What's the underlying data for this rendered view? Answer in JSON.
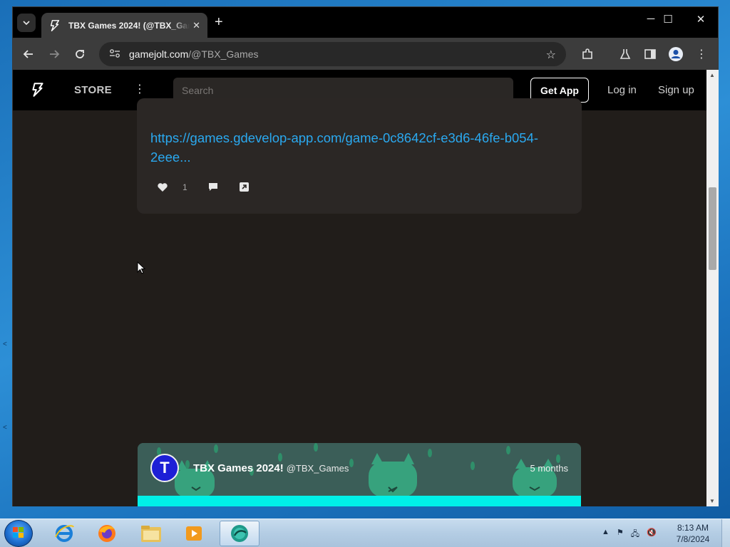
{
  "browser": {
    "tab_title": "TBX Games 2024! (@TBX_Gam",
    "tab_close": "✕",
    "new_tab": "+",
    "minimize": "─",
    "maximize": "☐",
    "close": "✕",
    "url_host": "gamejolt.com",
    "url_path": "/@TBX_Games"
  },
  "site": {
    "store_label": "STORE",
    "search_placeholder": "Search",
    "get_app_label": "Get App",
    "login_label": "Log in",
    "signup_label": "Sign up"
  },
  "post": {
    "link_text": "https://games.gdevelop-app.com/game-0c8642cf-e3d6-46fe-b054-2eee...",
    "like_count": "1"
  },
  "post2": {
    "author_name": "TBX Games 2024!",
    "author_handle": "@TBX_Games",
    "time_ago": "5 months"
  },
  "taskbar": {
    "time": "8:13 AM",
    "date": "7/8/2024"
  },
  "colors": {
    "link": "#2aa9f0",
    "page_bg": "#211d1a",
    "banner": "#00f0e8"
  }
}
